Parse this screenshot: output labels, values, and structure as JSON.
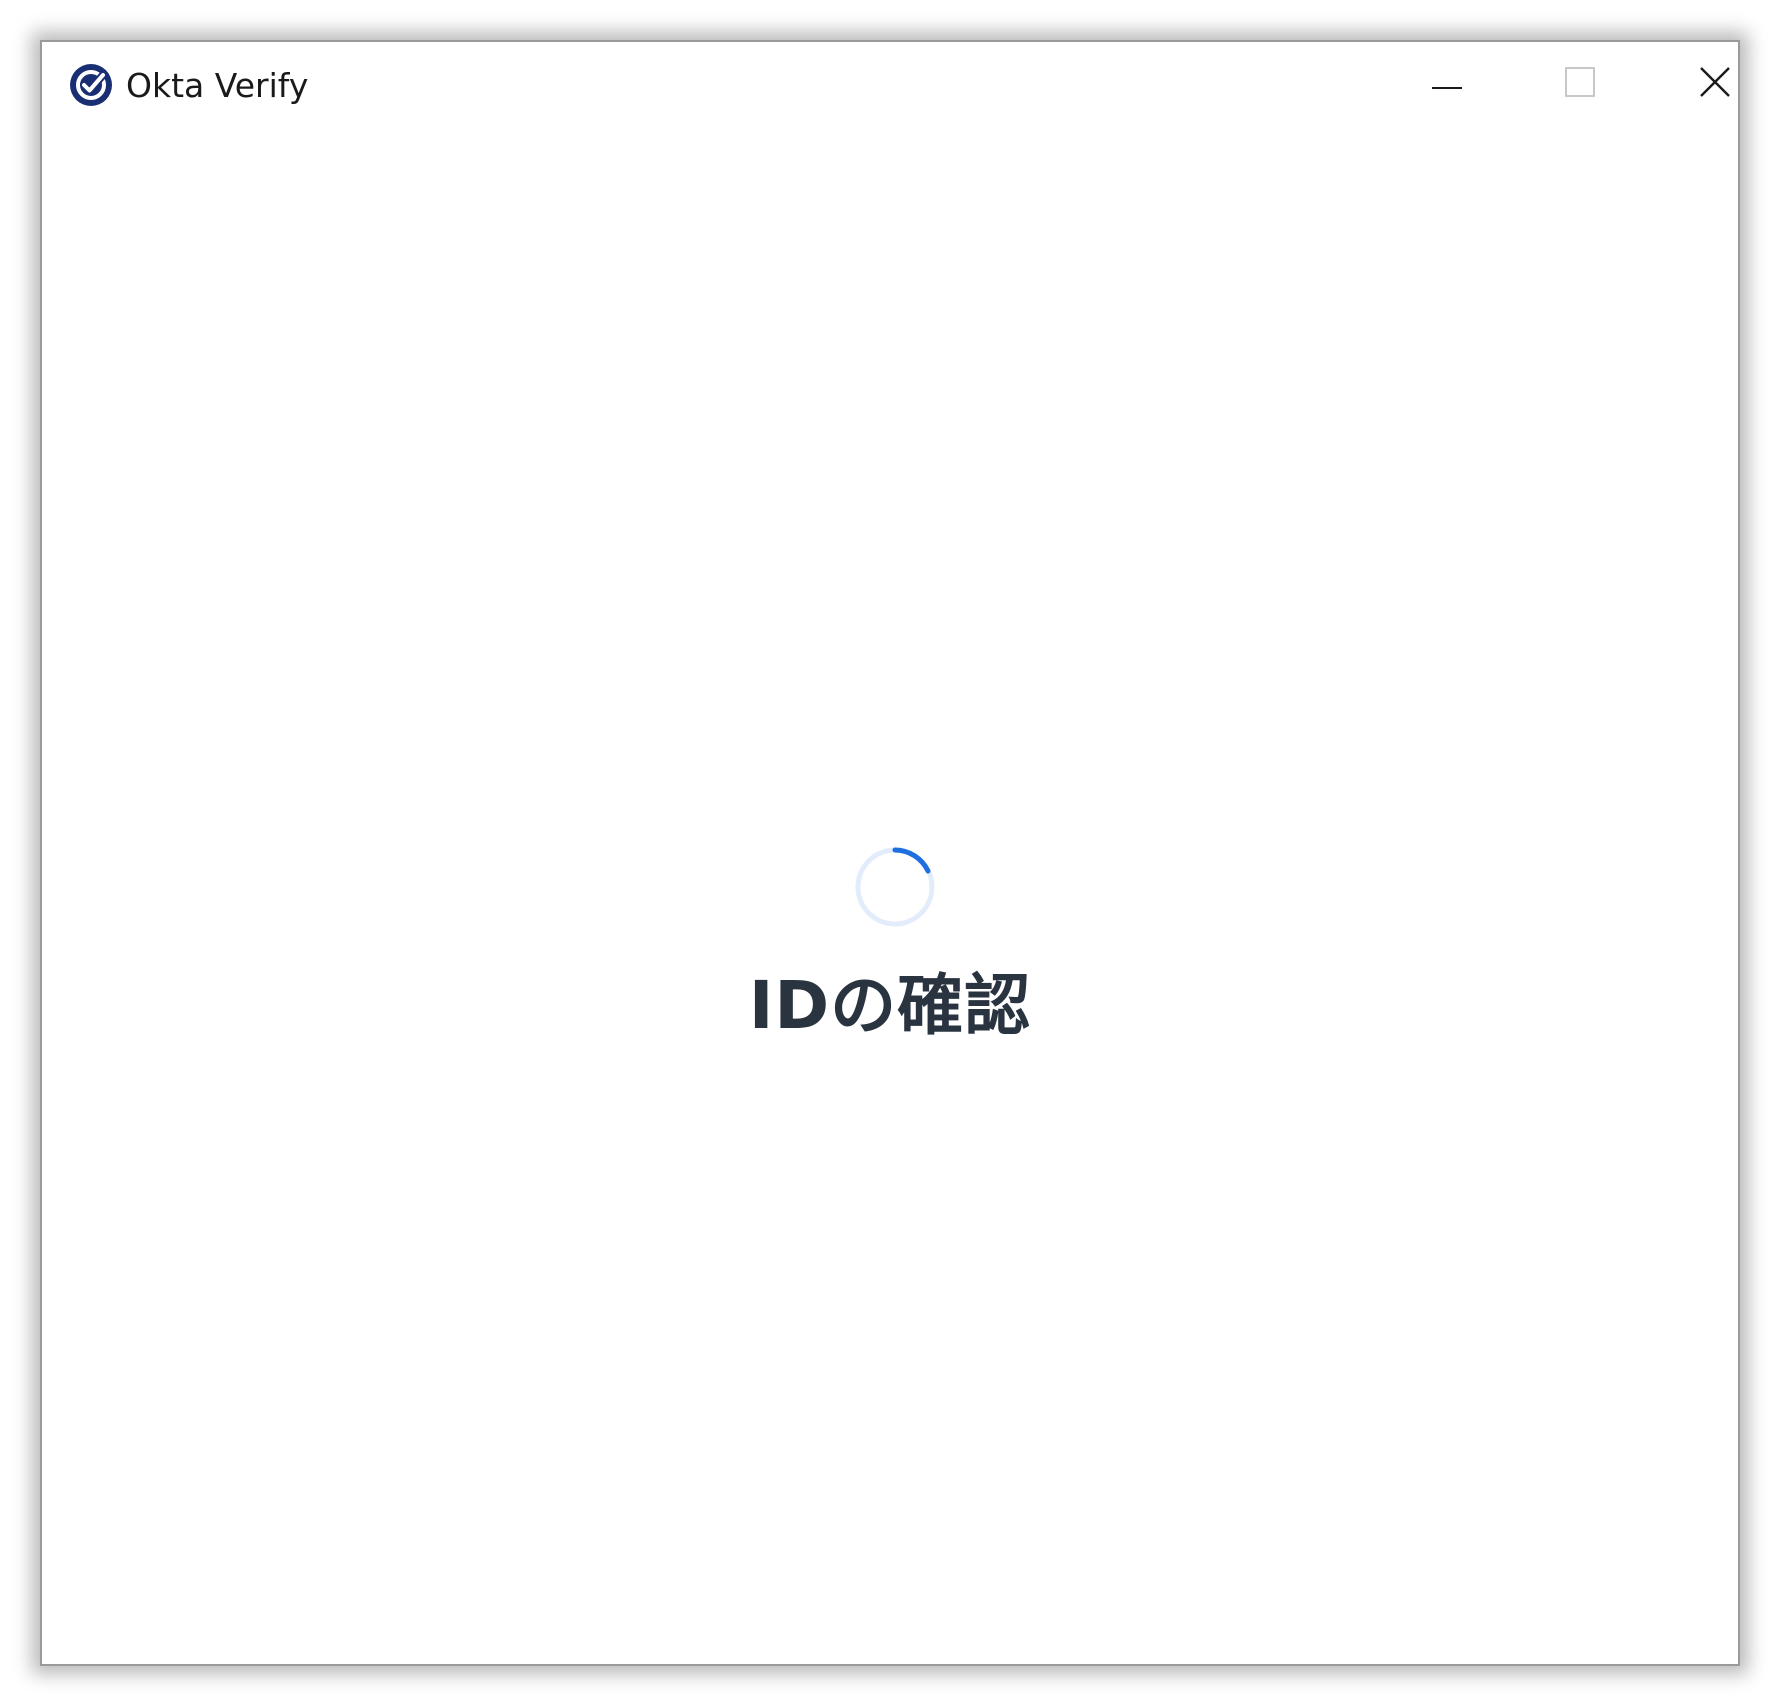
{
  "window": {
    "title": "Okta Verify",
    "app_icon": "okta-verify-check-icon",
    "controls": {
      "minimize_icon": "minimize-icon",
      "maximize_icon": "maximize-icon",
      "close_icon": "close-icon"
    }
  },
  "main": {
    "status_heading": "IDの確認",
    "spinner_icon": "loading-spinner-icon"
  },
  "colors": {
    "brand_navy": "#1a2f73",
    "spinner_accent": "#1f6fe0",
    "spinner_track": "#e3ecfb",
    "heading_text": "#2a3440"
  }
}
